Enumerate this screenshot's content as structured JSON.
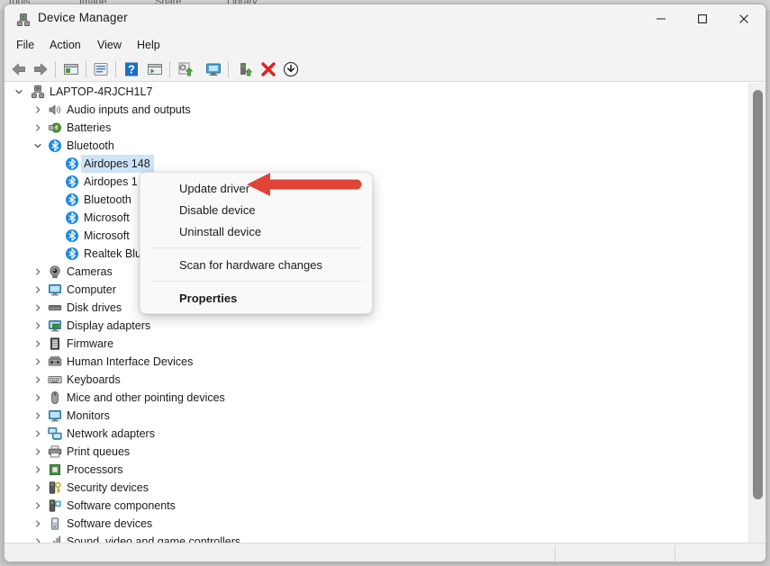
{
  "background_window": {
    "tabs": [
      "Tools",
      "Image",
      "Share",
      "Library"
    ]
  },
  "window": {
    "title": "Device Manager",
    "title_icon": "device-manager-icon",
    "controls": {
      "minimize": "—",
      "maximize": "☐",
      "close": "✕"
    }
  },
  "menubar": {
    "items": [
      {
        "label": "File"
      },
      {
        "label": "Action"
      },
      {
        "label": "View"
      },
      {
        "label": "Help"
      }
    ]
  },
  "toolbar": {
    "buttons": [
      {
        "name": "back-icon"
      },
      {
        "name": "forward-icon"
      },
      {
        "name": "show-hide-console-tree-icon"
      },
      {
        "name": "properties-icon"
      },
      {
        "name": "help-icon"
      },
      {
        "name": "update-driver-software-icon"
      },
      {
        "name": "scan-for-hardware-changes-icon"
      },
      {
        "name": "display-device-by-connection-icon"
      },
      {
        "name": "enable-device-icon"
      },
      {
        "name": "uninstall-device-icon"
      },
      {
        "name": "download-icon"
      }
    ]
  },
  "tree": {
    "root": {
      "label": "LAPTOP-4RJCH1L7",
      "icon": "computer-icon",
      "expanded": true
    },
    "nodes": [
      {
        "label": "Audio inputs and outputs",
        "icon": "speaker-icon",
        "expanded": false,
        "level": 1
      },
      {
        "label": "Batteries",
        "icon": "battery-icon",
        "expanded": false,
        "level": 1
      },
      {
        "label": "Bluetooth",
        "icon": "bluetooth-icon",
        "expanded": true,
        "level": 1
      },
      {
        "label": "Airdopes 148",
        "icon": "bluetooth-device-icon",
        "level": 2,
        "selected": true
      },
      {
        "label": "Airdopes 1",
        "icon": "bluetooth-device-icon",
        "level": 2
      },
      {
        "label": "Bluetooth",
        "icon": "bluetooth-device-icon",
        "level": 2
      },
      {
        "label": "Microsoft",
        "icon": "bluetooth-device-icon",
        "level": 2
      },
      {
        "label": "Microsoft",
        "icon": "bluetooth-device-icon",
        "level": 2
      },
      {
        "label": "Realtek Blu",
        "icon": "bluetooth-device-icon",
        "level": 2
      },
      {
        "label": "Cameras",
        "icon": "camera-icon",
        "expanded": false,
        "level": 1
      },
      {
        "label": "Computer",
        "icon": "monitor-icon",
        "expanded": false,
        "level": 1
      },
      {
        "label": "Disk drives",
        "icon": "disk-icon",
        "expanded": false,
        "level": 1
      },
      {
        "label": "Display adapters",
        "icon": "display-adapter-icon",
        "expanded": false,
        "level": 1
      },
      {
        "label": "Firmware",
        "icon": "firmware-icon",
        "expanded": false,
        "level": 1
      },
      {
        "label": "Human Interface Devices",
        "icon": "hid-icon",
        "expanded": false,
        "level": 1
      },
      {
        "label": "Keyboards",
        "icon": "keyboard-icon",
        "expanded": false,
        "level": 1
      },
      {
        "label": "Mice and other pointing devices",
        "icon": "mouse-icon",
        "expanded": false,
        "level": 1
      },
      {
        "label": "Monitors",
        "icon": "monitor-icon",
        "expanded": false,
        "level": 1
      },
      {
        "label": "Network adapters",
        "icon": "network-icon",
        "expanded": false,
        "level": 1
      },
      {
        "label": "Print queues",
        "icon": "printer-icon",
        "expanded": false,
        "level": 1
      },
      {
        "label": "Processors",
        "icon": "processor-icon",
        "expanded": false,
        "level": 1
      },
      {
        "label": "Security devices",
        "icon": "security-device-icon",
        "expanded": false,
        "level": 1
      },
      {
        "label": "Software components",
        "icon": "software-component-icon",
        "expanded": false,
        "level": 1
      },
      {
        "label": "Software devices",
        "icon": "software-device-icon",
        "expanded": false,
        "level": 1
      },
      {
        "label": "Sound, video and game controllers",
        "icon": "sound-controller-icon",
        "expanded": false,
        "level": 1
      }
    ]
  },
  "context_menu": {
    "items": [
      {
        "label": "Update driver",
        "bold": false,
        "type": "item"
      },
      {
        "label": "Disable device",
        "bold": false,
        "type": "item"
      },
      {
        "label": "Uninstall device",
        "bold": false,
        "type": "item"
      },
      {
        "type": "separator"
      },
      {
        "label": "Scan for hardware changes",
        "bold": false,
        "type": "item"
      },
      {
        "type": "separator"
      },
      {
        "label": "Properties",
        "bold": true,
        "type": "item"
      }
    ]
  },
  "annotation": {
    "arrow": "red-left-arrow",
    "color": "#e04437",
    "points_at": "Update driver"
  },
  "statusbar": {
    "text": ""
  }
}
